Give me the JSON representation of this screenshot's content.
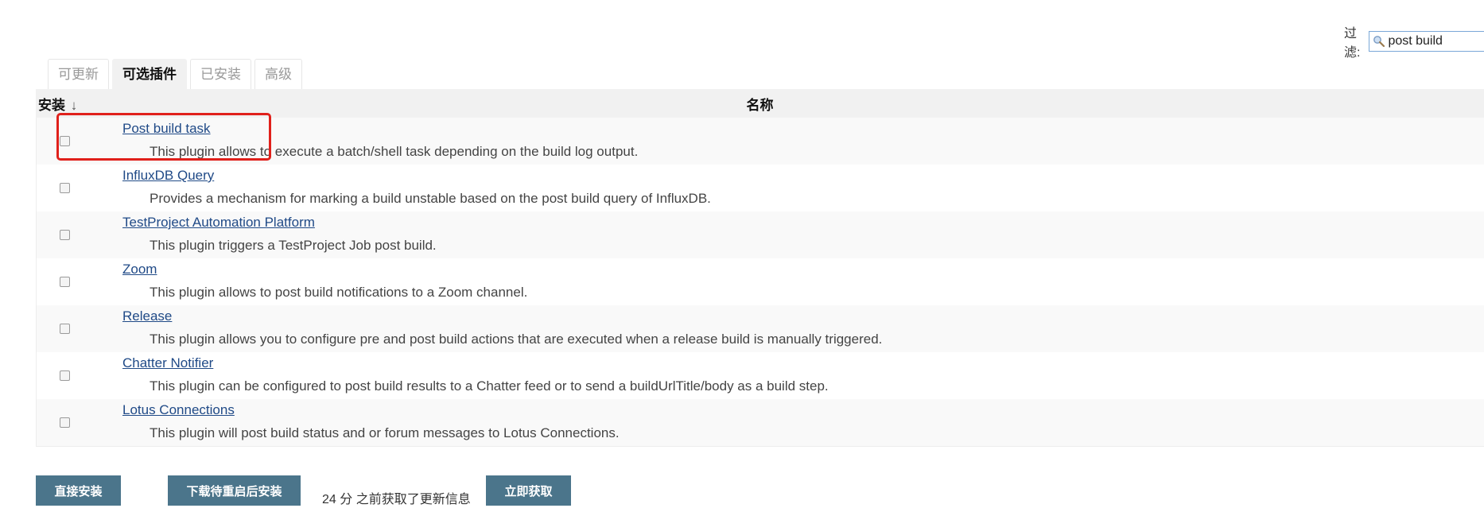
{
  "filter": {
    "label": "过滤:",
    "value": "post build"
  },
  "tabs": [
    {
      "label": "可更新",
      "active": false
    },
    {
      "label": "可选插件",
      "active": true
    },
    {
      "label": "已安装",
      "active": false
    },
    {
      "label": "高级",
      "active": false
    }
  ],
  "table": {
    "header_install": "安装",
    "header_sort_arrow": "↓",
    "header_name": "名称",
    "rows": [
      {
        "name": "Post build task",
        "description": "This plugin allows to execute a batch/shell task depending on the build log output."
      },
      {
        "name": "InfluxDB Query",
        "description": "Provides a mechanism for marking a build unstable based on the post build query of InfluxDB."
      },
      {
        "name": "TestProject Automation Platform",
        "description": "This plugin triggers a TestProject Job post build."
      },
      {
        "name": "Zoom",
        "description": "This plugin allows to post build notifications to a Zoom channel."
      },
      {
        "name": "Release",
        "description": "This plugin allows you to configure pre and post build actions that are executed when a release build is manually triggered."
      },
      {
        "name": "Chatter Notifier",
        "description": "This plugin can be configured to post build results to a Chatter feed or to send a buildUrlTitle/body as a build step."
      },
      {
        "name": "Lotus Connections",
        "description": "This plugin will post build status and or forum messages to Lotus Connections."
      }
    ]
  },
  "footer": {
    "install_button": "直接安装",
    "download_button": "下载待重启后安装",
    "update_info": "24 分 之前获取了更新信息",
    "fetch_button": "立即获取"
  },
  "colors": {
    "button_bg": "#4b758b",
    "link": "#204a87",
    "highlight_border": "#e0201b"
  }
}
